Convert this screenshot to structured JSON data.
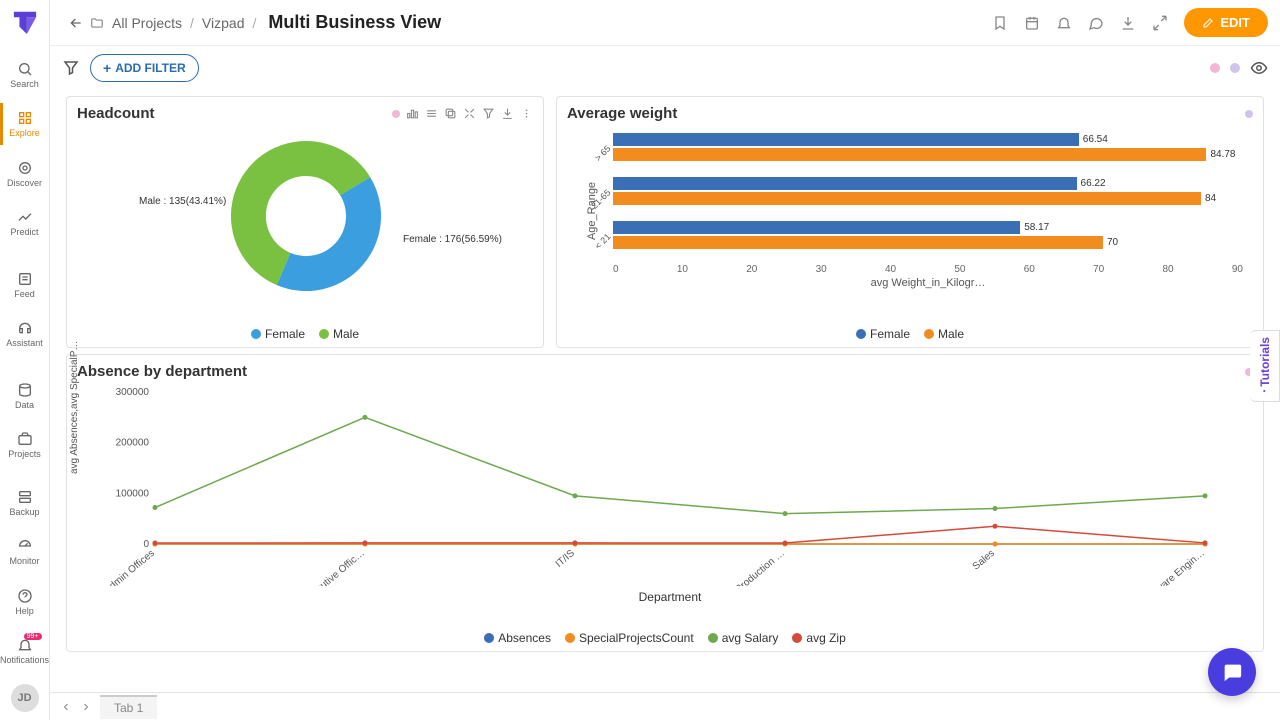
{
  "breadcrumbs": {
    "root": "All Projects",
    "mid": "Vizpad"
  },
  "page_title": "Multi Business View",
  "edit_label": "EDIT",
  "add_filter_label": "ADD FILTER",
  "nav": {
    "search": "Search",
    "explore": "Explore",
    "discover": "Discover",
    "predict": "Predict",
    "feed": "Feed",
    "assistant": "Assistant",
    "data": "Data",
    "projects": "Projects",
    "backup": "Backup",
    "monitor": "Monitor",
    "help": "Help",
    "notifications": "Notifications",
    "notif_badge": "99+"
  },
  "avatar_initials": "JD",
  "tab1": "Tab 1",
  "tutorials_label": "Tutorials",
  "colors": {
    "female": "#3b9ede",
    "male": "#7ac142",
    "orange": "#f28c1f",
    "green_line": "#6fa84f",
    "red_line": "#d44a3a",
    "purple": "#b084e0"
  },
  "cards": {
    "headcount": {
      "title": "Headcount",
      "legend": [
        "Female",
        "Male"
      ],
      "label_female": "Female : 176(56.59%)",
      "label_male": "Male : 135(43.41%)"
    },
    "avgweight": {
      "title": "Average weight",
      "ylabel": "Age_Range",
      "xlabel": "avg Weight_in_Kilogr…",
      "legend": [
        "Female",
        "Male"
      ],
      "categories": [
        "> 65",
        "21-65",
        "< 21"
      ],
      "xticks": [
        "0",
        "10",
        "20",
        "30",
        "40",
        "50",
        "60",
        "70",
        "80",
        "90"
      ]
    },
    "absence": {
      "title": "Absence by department",
      "ylabel": "avg Absences,avg SpecialP…",
      "xlabel": "Department",
      "legend": [
        "Absences",
        "SpecialProjectsCount",
        "avg Salary",
        "avg Zip"
      ],
      "yticks": [
        "0",
        "100000",
        "200000",
        "300000"
      ],
      "xticks": [
        "Admin Offices",
        "Executive Offic…",
        "IT/IS",
        "Production …",
        "Sales",
        "Software Engin…"
      ]
    }
  },
  "chart_data": [
    {
      "type": "pie",
      "title": "Headcount",
      "series": [
        {
          "name": "Female",
          "value": 176,
          "pct": 56.59
        },
        {
          "name": "Male",
          "value": 135,
          "pct": 43.41
        }
      ]
    },
    {
      "type": "bar",
      "title": "Average weight",
      "orientation": "horizontal",
      "ylabel": "Age_Range",
      "xlabel": "avg Weight_in_Kilograms",
      "categories": [
        "> 65",
        "21-65",
        "< 21"
      ],
      "series": [
        {
          "name": "Female",
          "values": [
            66.54,
            66.22,
            58.17
          ]
        },
        {
          "name": "Male",
          "values": [
            84.78,
            84.0,
            70.0
          ]
        }
      ],
      "xlim": [
        0,
        90
      ]
    },
    {
      "type": "line",
      "title": "Absence by department",
      "xlabel": "Department",
      "ylabel": "avg Absences, avg SpecialProjectsCount",
      "categories": [
        "Admin Offices",
        "Executive Office",
        "IT/IS",
        "Production",
        "Sales",
        "Software Engineering"
      ],
      "series": [
        {
          "name": "Absences",
          "values": [
            10,
            9,
            10,
            11,
            10,
            9
          ]
        },
        {
          "name": "SpecialProjectsCount",
          "values": [
            1,
            2,
            4,
            0,
            1,
            2
          ]
        },
        {
          "name": "avg Salary",
          "values": [
            72000,
            250000,
            95000,
            60000,
            70000,
            95000
          ]
        },
        {
          "name": "avg Zip",
          "values": [
            2000,
            2100,
            2100,
            2050,
            35000,
            2100
          ]
        }
      ],
      "ylim": [
        0,
        300000
      ]
    }
  ]
}
